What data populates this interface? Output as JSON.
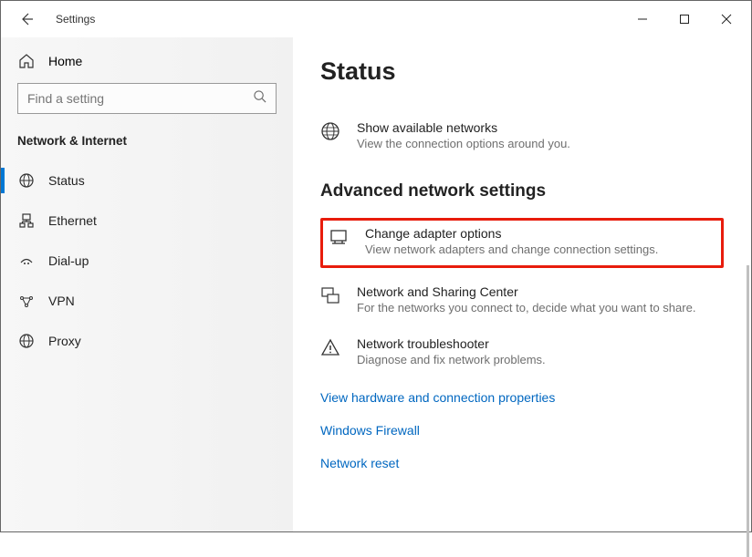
{
  "window": {
    "title": "Settings"
  },
  "home_label": "Home",
  "search": {
    "placeholder": "Find a setting"
  },
  "section": "Network & Internet",
  "nav": {
    "status": "Status",
    "ethernet": "Ethernet",
    "dialup": "Dial-up",
    "vpn": "VPN",
    "proxy": "Proxy"
  },
  "page": {
    "title": "Status",
    "show_networks": {
      "title": "Show available networks",
      "desc": "View the connection options around you."
    },
    "advanced_header": "Advanced network settings",
    "change_adapter": {
      "title": "Change adapter options",
      "desc": "View network adapters and change connection settings."
    },
    "sharing_center": {
      "title": "Network and Sharing Center",
      "desc": "For the networks you connect to, decide what you want to share."
    },
    "troubleshooter": {
      "title": "Network troubleshooter",
      "desc": "Diagnose and fix network problems."
    },
    "links": {
      "hardware": "View hardware and connection properties",
      "firewall": "Windows Firewall",
      "reset": "Network reset"
    }
  }
}
